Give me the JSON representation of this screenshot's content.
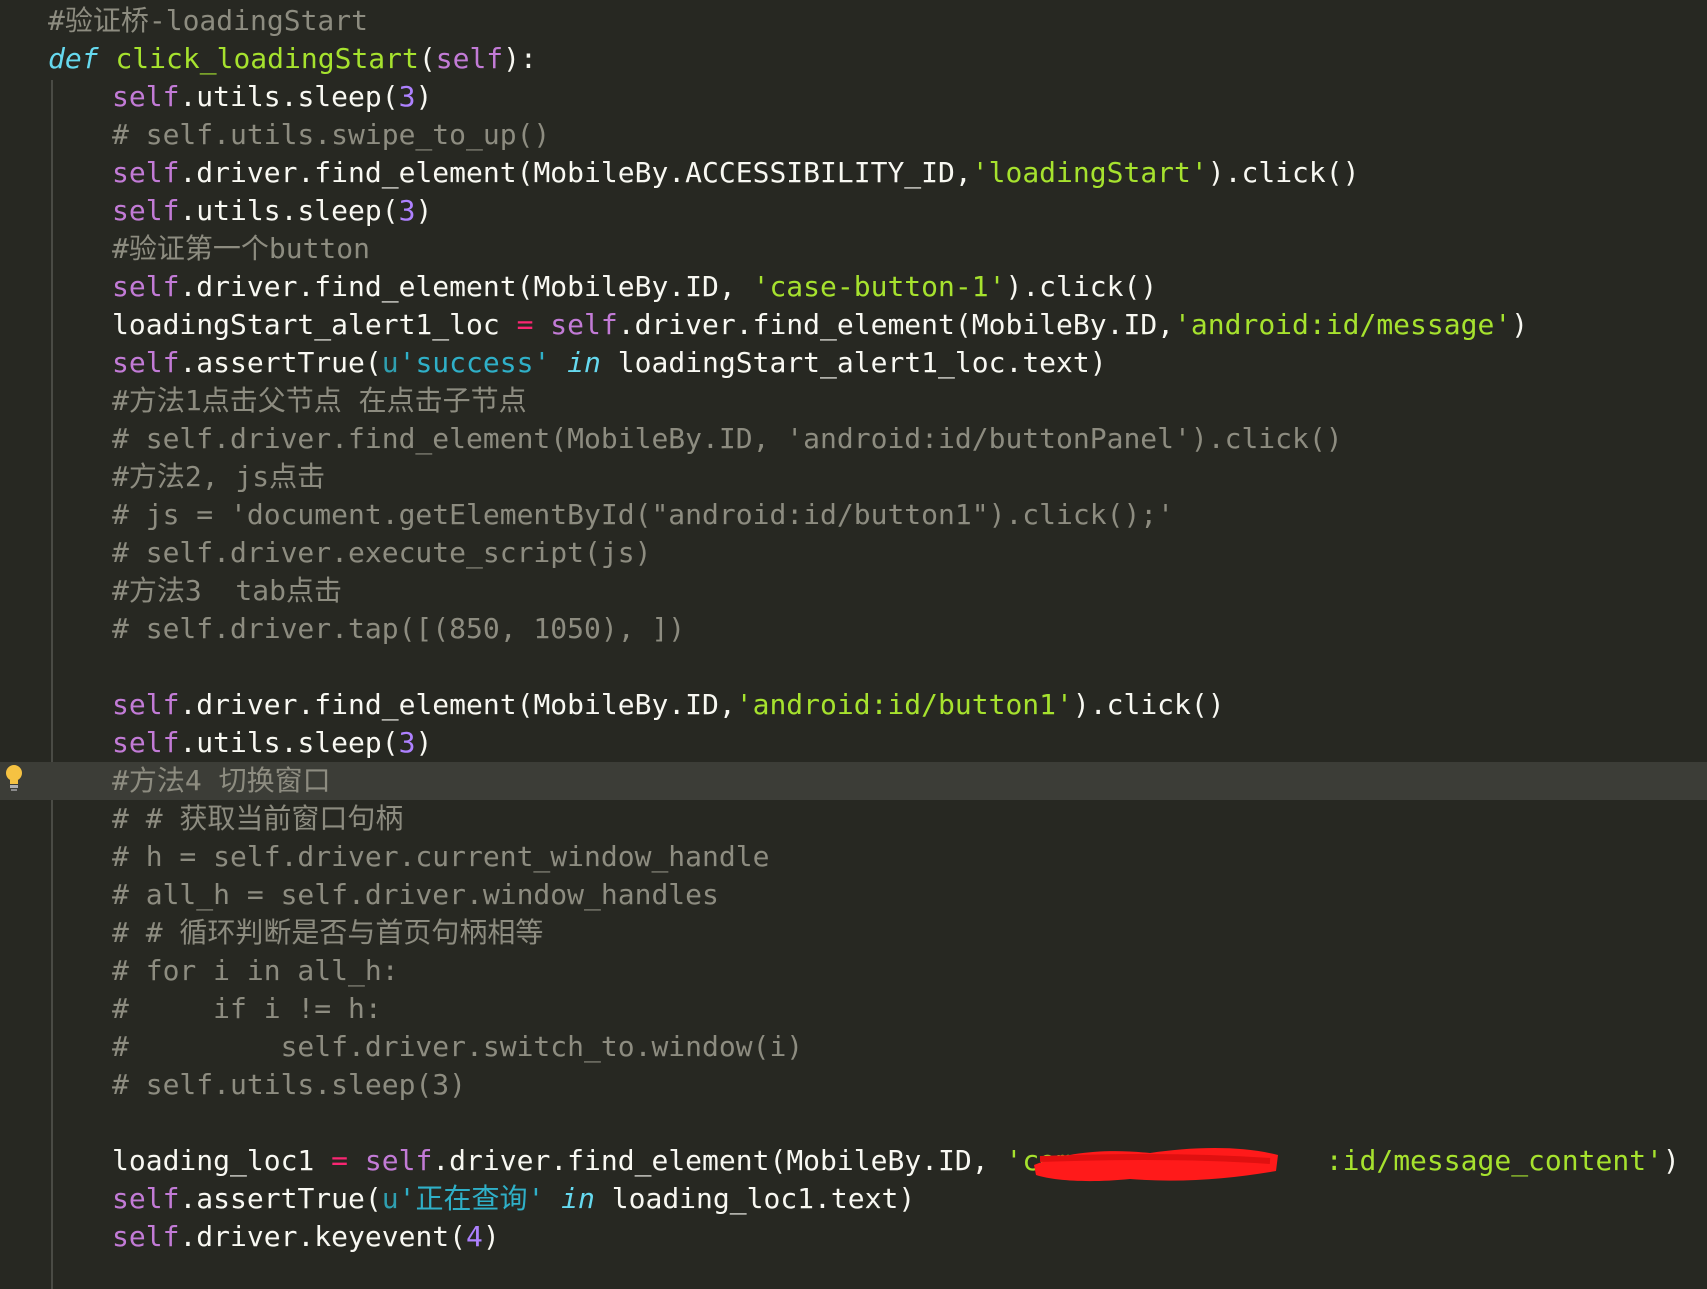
{
  "editor": {
    "lines": [
      {
        "indent": 48,
        "tokens": [
          {
            "t": "#验证桥-loadingStart",
            "c": "cm"
          }
        ]
      },
      {
        "indent": 48,
        "tokens": [
          {
            "t": "def",
            "c": "kw"
          },
          {
            "t": " ",
            "c": "plain"
          },
          {
            "t": "click_loadingStart",
            "c": "fn"
          },
          {
            "t": "(",
            "c": "plain"
          },
          {
            "t": "self",
            "c": "self"
          },
          {
            "t": "):",
            "c": "plain"
          }
        ]
      },
      {
        "indent": 112,
        "tokens": [
          {
            "t": "self",
            "c": "self"
          },
          {
            "t": ".utils.sleep(",
            "c": "plain"
          },
          {
            "t": "3",
            "c": "num"
          },
          {
            "t": ")",
            "c": "plain"
          }
        ]
      },
      {
        "indent": 112,
        "tokens": [
          {
            "t": "# self.utils.swipe_to_up()",
            "c": "cm"
          }
        ]
      },
      {
        "indent": 112,
        "tokens": [
          {
            "t": "self",
            "c": "self"
          },
          {
            "t": ".driver.find_element(MobileBy.ACCESSIBILITY_ID,",
            "c": "plain"
          },
          {
            "t": "'loadingStart'",
            "c": "str"
          },
          {
            "t": ").click()",
            "c": "plain"
          }
        ]
      },
      {
        "indent": 112,
        "tokens": [
          {
            "t": "self",
            "c": "self"
          },
          {
            "t": ".utils.sleep(",
            "c": "plain"
          },
          {
            "t": "3",
            "c": "num"
          },
          {
            "t": ")",
            "c": "plain"
          }
        ]
      },
      {
        "indent": 112,
        "tokens": [
          {
            "t": "#验证第一个button",
            "c": "cm"
          }
        ]
      },
      {
        "indent": 112,
        "tokens": [
          {
            "t": "self",
            "c": "self"
          },
          {
            "t": ".driver.find_element(MobileBy.ID, ",
            "c": "plain"
          },
          {
            "t": "'case-button-1'",
            "c": "str"
          },
          {
            "t": ").click()",
            "c": "plain"
          }
        ]
      },
      {
        "indent": 112,
        "tokens": [
          {
            "t": "loadingStart_alert1_loc ",
            "c": "plain"
          },
          {
            "t": "=",
            "c": "op"
          },
          {
            "t": " ",
            "c": "plain"
          },
          {
            "t": "self",
            "c": "self"
          },
          {
            "t": ".driver.find_element(MobileBy.ID,",
            "c": "plain"
          },
          {
            "t": "'android:id/message'",
            "c": "str"
          },
          {
            "t": ")",
            "c": "plain"
          }
        ]
      },
      {
        "indent": 112,
        "tokens": [
          {
            "t": "self",
            "c": "self"
          },
          {
            "t": ".assertTrue(",
            "c": "plain"
          },
          {
            "t": "u",
            "c": "pfx"
          },
          {
            "t": "'success'",
            "c": "ustr"
          },
          {
            "t": " ",
            "c": "plain"
          },
          {
            "t": "in",
            "c": "kw"
          },
          {
            "t": " loadingStart_alert1_loc.text)",
            "c": "plain"
          }
        ]
      },
      {
        "indent": 112,
        "tokens": [
          {
            "t": "#方法1点击父节点 在点击子节点",
            "c": "cm"
          }
        ]
      },
      {
        "indent": 112,
        "tokens": [
          {
            "t": "# self.driver.find_element(MobileBy.ID, 'android:id/buttonPanel').click()",
            "c": "cm"
          }
        ]
      },
      {
        "indent": 112,
        "tokens": [
          {
            "t": "#方法2, js点击",
            "c": "cm"
          }
        ]
      },
      {
        "indent": 112,
        "tokens": [
          {
            "t": "# js = 'document.getElementById(\"android:id/button1\").click();'",
            "c": "cm"
          }
        ]
      },
      {
        "indent": 112,
        "tokens": [
          {
            "t": "# self.driver.execute_script(js)",
            "c": "cm"
          }
        ]
      },
      {
        "indent": 112,
        "tokens": [
          {
            "t": "#方法3  tab点击",
            "c": "cm"
          }
        ]
      },
      {
        "indent": 112,
        "tokens": [
          {
            "t": "# self.driver.tap([(850, 1050), ])",
            "c": "cm"
          }
        ]
      },
      {
        "indent": 112,
        "tokens": []
      },
      {
        "indent": 112,
        "tokens": [
          {
            "t": "self",
            "c": "self"
          },
          {
            "t": ".driver.find_element(MobileBy.ID,",
            "c": "plain"
          },
          {
            "t": "'android:id/button1'",
            "c": "str"
          },
          {
            "t": ").click()",
            "c": "plain"
          }
        ]
      },
      {
        "indent": 112,
        "tokens": [
          {
            "t": "self",
            "c": "self"
          },
          {
            "t": ".utils.sleep(",
            "c": "plain"
          },
          {
            "t": "3",
            "c": "num"
          },
          {
            "t": ")",
            "c": "plain"
          }
        ]
      },
      {
        "indent": 112,
        "highlight": true,
        "tokens": [
          {
            "t": "#方法4 切换窗口",
            "c": "cm"
          }
        ]
      },
      {
        "indent": 112,
        "tokens": [
          {
            "t": "# # 获取当前窗口句柄",
            "c": "cm"
          }
        ]
      },
      {
        "indent": 112,
        "tokens": [
          {
            "t": "# h = self.driver.current_window_handle",
            "c": "cm"
          }
        ]
      },
      {
        "indent": 112,
        "tokens": [
          {
            "t": "# all_h = self.driver.window_handles",
            "c": "cm"
          }
        ]
      },
      {
        "indent": 112,
        "tokens": [
          {
            "t": "# # 循环判断是否与首页句柄相等",
            "c": "cm"
          }
        ]
      },
      {
        "indent": 112,
        "tokens": [
          {
            "t": "# for i in all_h:",
            "c": "cm"
          }
        ]
      },
      {
        "indent": 112,
        "tokens": [
          {
            "t": "#     if i != h:",
            "c": "cm"
          }
        ]
      },
      {
        "indent": 112,
        "tokens": [
          {
            "t": "#         self.driver.switch_to.window(i)",
            "c": "cm"
          }
        ]
      },
      {
        "indent": 112,
        "tokens": [
          {
            "t": "# self.utils.sleep(3)",
            "c": "cm"
          }
        ]
      },
      {
        "indent": 112,
        "tokens": []
      },
      {
        "indent": 112,
        "tokens": [
          {
            "t": "loading_loc1 ",
            "c": "plain"
          },
          {
            "t": "=",
            "c": "op"
          },
          {
            "t": " ",
            "c": "plain"
          },
          {
            "t": "self",
            "c": "self"
          },
          {
            "t": ".driver.find_element(MobileBy.ID, ",
            "c": "plain"
          },
          {
            "t": "'com.              :id/message_content'",
            "c": "str"
          },
          {
            "t": ")",
            "c": "plain"
          }
        ]
      },
      {
        "indent": 112,
        "tokens": [
          {
            "t": "self",
            "c": "self"
          },
          {
            "t": ".assertTrue(",
            "c": "plain"
          },
          {
            "t": "u",
            "c": "pfx"
          },
          {
            "t": "'正在查询'",
            "c": "ustr"
          },
          {
            "t": " ",
            "c": "plain"
          },
          {
            "t": "in",
            "c": "kw"
          },
          {
            "t": " loading_loc1.text)",
            "c": "plain"
          }
        ]
      },
      {
        "indent": 112,
        "tokens": [
          {
            "t": "self",
            "c": "self"
          },
          {
            "t": ".driver.keyevent(",
            "c": "plain"
          },
          {
            "t": "4",
            "c": "num"
          },
          {
            "t": ")",
            "c": "plain"
          }
        ]
      }
    ]
  },
  "gutter": {
    "hint_icon": "lightbulb-icon"
  },
  "redaction": {
    "color": "#ff1a1a"
  }
}
